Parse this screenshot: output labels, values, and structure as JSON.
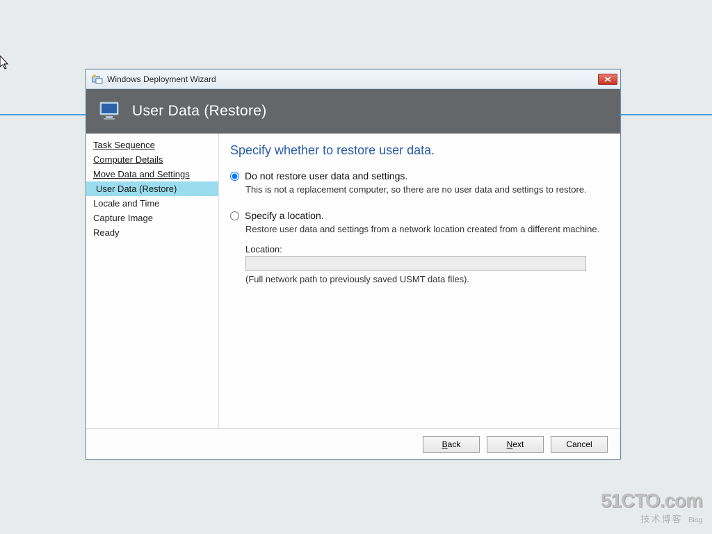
{
  "window": {
    "title": "Windows Deployment Wizard"
  },
  "header": {
    "title": "User Data (Restore)"
  },
  "sidebar": {
    "items": [
      {
        "label": "Task Sequence",
        "state": "visited"
      },
      {
        "label": "Computer Details",
        "state": "visited"
      },
      {
        "label": "Move Data and Settings",
        "state": "visited"
      },
      {
        "label": "User Data (Restore)",
        "state": "current"
      },
      {
        "label": "Locale and Time",
        "state": "upcoming"
      },
      {
        "label": "Capture Image",
        "state": "upcoming"
      },
      {
        "label": "Ready",
        "state": "upcoming"
      }
    ]
  },
  "content": {
    "heading": "Specify whether to restore user data.",
    "option1": {
      "label": "Do not restore user data and settings.",
      "desc": "This is not a replacement computer, so there are no user data and settings to restore.",
      "selected": true
    },
    "option2": {
      "label": "Specify a location.",
      "desc": "Restore user data and settings from a network location created from a different machine.",
      "selected": false
    },
    "location_label": "Location:",
    "location_value": "",
    "location_hint": "(Full network path to previously saved USMT data files)."
  },
  "footer": {
    "back": "Back",
    "next": "Next",
    "cancel": "Cancel"
  },
  "watermark": {
    "line1": "51CTO.com",
    "line2": "技术博客",
    "tag": "Blog"
  }
}
